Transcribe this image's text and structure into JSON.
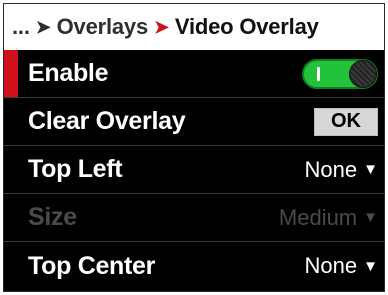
{
  "breadcrumb": {
    "ellipsis": "...",
    "parent": "Overlays",
    "current": "Video Overlay",
    "sep_parent": "➤",
    "sep_current": "➤"
  },
  "rows": [
    {
      "label": "Enable",
      "toggle_state": "on"
    },
    {
      "label": "Clear Overlay",
      "button_label": "OK"
    },
    {
      "label": "Top Left",
      "value": "None"
    },
    {
      "label": "Size",
      "value": "Medium",
      "disabled": true
    },
    {
      "label": "Top Center",
      "value": "None"
    }
  ],
  "colors": {
    "accent_red": "#d0111b",
    "toggle_on_green": "#22c33a",
    "background": "#000000",
    "disabled_text": "#4a4a4a"
  },
  "icons": {
    "chevron": "chevron-down-icon",
    "toggle_knob": "toggle-knob-icon"
  }
}
